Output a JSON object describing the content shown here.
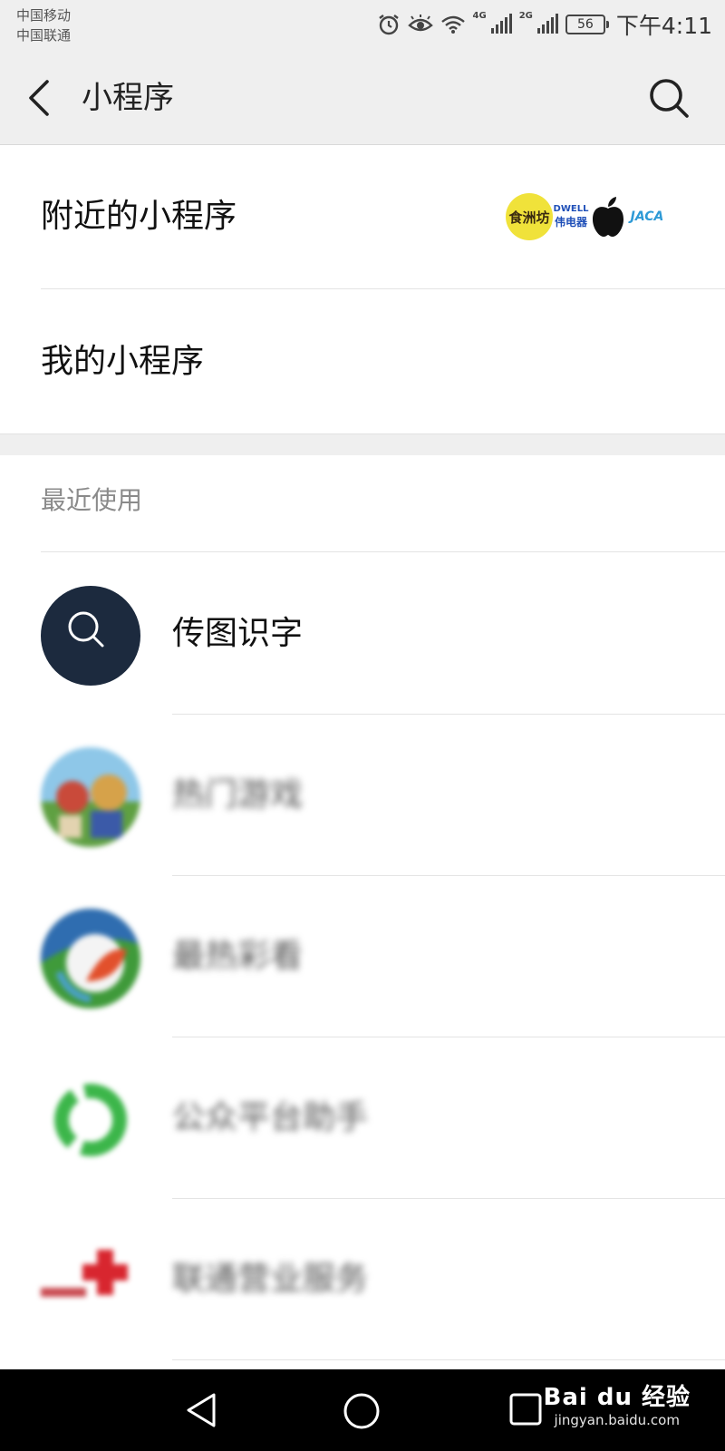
{
  "status_bar": {
    "carrier_1": "中国移动",
    "carrier_2": "中国联通",
    "network_1": "4G",
    "network_2": "2G",
    "battery": "56",
    "time": "下午4:11",
    "icons": [
      "alarm-icon",
      "eye-icon",
      "wifi-icon",
      "signal-icon",
      "signal-icon",
      "battery-icon"
    ]
  },
  "header": {
    "title": "小程序",
    "back_icon": "chevron-left-icon",
    "search_icon": "search-icon"
  },
  "entries": {
    "nearby": {
      "label": "附近的小程序",
      "logos": {
        "logo_1_text": "食洲坊",
        "logo_2_line1": "DWELL",
        "logo_2_line2": "伟电器",
        "logo_4_text": "JACA"
      }
    },
    "mine": {
      "label": "我的小程序"
    }
  },
  "recent": {
    "header": "最近使用",
    "items": [
      {
        "name": "传图识字",
        "icon": "search-icon",
        "icon_bg": "#1c2a3e"
      },
      {
        "name": "热门游戏",
        "icon": "game-avatar-icon"
      },
      {
        "name": "最热彩看",
        "icon": "colorful-avatar-icon"
      },
      {
        "name": "公众平台助手",
        "icon": "green-ring-icon"
      },
      {
        "name": "联通营业服务",
        "icon": "red-cross-logo-icon"
      }
    ]
  },
  "nav_bar": {
    "back_icon": "triangle-back-icon",
    "home_icon": "circle-home-icon",
    "recent_icon": "square-recent-icon",
    "watermark_line1": "Bai du 经验",
    "watermark_line2": "jingyan.baidu.com"
  },
  "colors": {
    "header_bg": "#efefef",
    "divider": "#e4e4e4",
    "secondary_text": "#8a8a8a",
    "nav_bg": "#000000"
  }
}
